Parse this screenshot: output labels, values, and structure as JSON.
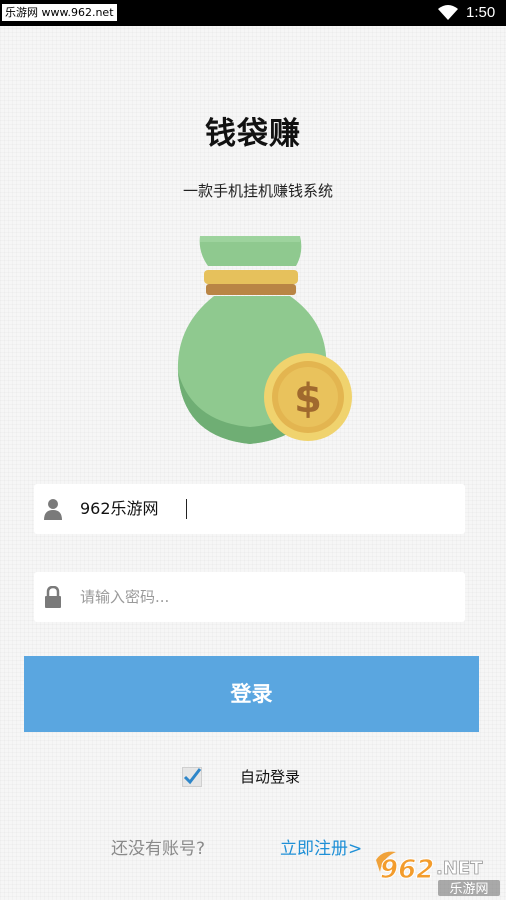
{
  "status_bar": {
    "watermark": "乐游网 www.962.net",
    "time": "1:50"
  },
  "app": {
    "title": "钱袋赚",
    "subtitle": "一款手机挂机赚钱系统"
  },
  "login_form": {
    "username_value": "962乐游网",
    "password_placeholder": "请输入密码...",
    "login_label": "登录",
    "auto_login_label": "自动登录",
    "auto_login_checked": true
  },
  "footer": {
    "no_account_text": "还没有账号?",
    "register_link": "立即注册>"
  },
  "watermark_logo": {
    "number": "962",
    "suffix": ".NET",
    "caption": "乐游网"
  },
  "colors": {
    "accent": "#5aa6e0",
    "link": "#1e8fd6",
    "bag_green": "#8fc98f",
    "coin_gold": "#f2d16b"
  }
}
